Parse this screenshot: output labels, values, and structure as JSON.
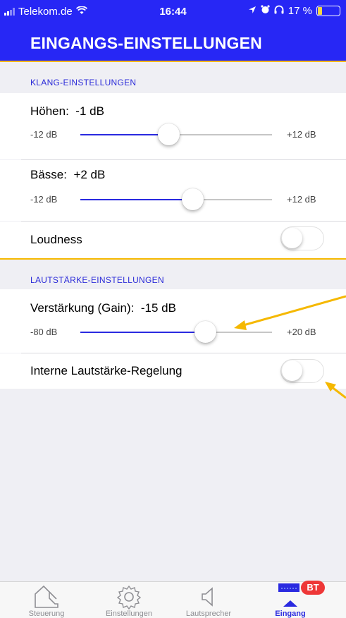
{
  "status": {
    "carrier": "Telekom.de",
    "time": "16:44",
    "battery": "17 %"
  },
  "header": {
    "title": "EINGANGS-EINSTELLUNGEN"
  },
  "sound_section": {
    "title": "KLANG-EINSTELLUNGEN"
  },
  "treble": {
    "label": "Höhen:",
    "value": "-1 dB",
    "min": "-12 dB",
    "max": "+12 dB",
    "level": 0.458
  },
  "bass": {
    "label": "Bässe:",
    "value": "+2 dB",
    "min": "-12 dB",
    "max": "+12 dB",
    "level": 0.583
  },
  "loudness": {
    "label": "Loudness",
    "on": false
  },
  "volume_section": {
    "title": "LAUTSTÄRKE-EINSTELLUNGEN"
  },
  "gain": {
    "label": "Verstärkung (Gain):",
    "value": "-15 dB",
    "min": "-80 dB",
    "max": "+20 dB",
    "level": 0.65
  },
  "internal_volume": {
    "label": "Interne Lautstärke-Regelung",
    "on": false
  },
  "tabs": [
    {
      "label": "Steuerung",
      "icon": "house-icon"
    },
    {
      "label": "Einstellungen",
      "icon": "gear-icon"
    },
    {
      "label": "Lautsprecher",
      "icon": "speaker-icon"
    },
    {
      "label": "Eingang",
      "icon": "input-icon"
    }
  ],
  "bt_badge": "BT",
  "colors": {
    "accent": "#2727f5",
    "highlight": "#f5b800",
    "badge": "#ee3737"
  }
}
